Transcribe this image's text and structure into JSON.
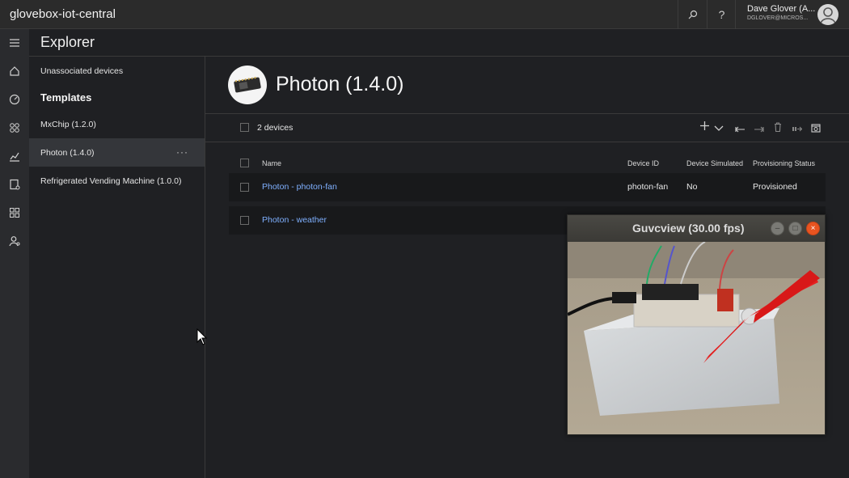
{
  "app": {
    "title": "glovebox-iot-central"
  },
  "topbar": {
    "search_icon": "search-icon",
    "help_label": "?",
    "user_name": "Dave Glover (A...",
    "user_email": "DGLOVER@MICROS..."
  },
  "rail": {
    "items": [
      "menu-icon",
      "home-icon",
      "dashboard-icon",
      "devices-icon",
      "analytics-icon",
      "jobs-icon",
      "templates-icon",
      "admin-icon"
    ]
  },
  "explorer": {
    "title": "Explorer"
  },
  "leftpanel": {
    "unassociated": "Unassociated devices",
    "templates_heading": "Templates",
    "templates": [
      {
        "label": "MxChip (1.2.0)"
      },
      {
        "label": "Photon (1.4.0)",
        "more": "···"
      },
      {
        "label": "Refrigerated Vending Machine (1.0.0)"
      }
    ]
  },
  "main": {
    "template_title": "Photon (1.4.0)",
    "device_count": "2 devices",
    "columns": {
      "name": "Name",
      "device_id": "Device ID",
      "simulated": "Device Simulated",
      "status": "Provisioning Status"
    },
    "rows": [
      {
        "name": "Photon - photon-fan",
        "device_id": "photon-fan",
        "simulated": "No",
        "status": "Provisioned"
      },
      {
        "name": "Photon - weather",
        "device_id": "",
        "simulated": "",
        "status": ""
      }
    ]
  },
  "guvcview": {
    "title": "Guvcview   (30.00 fps)",
    "min": "–",
    "max": "□",
    "close": "×"
  },
  "colors": {
    "link": "#7fb0ff",
    "close_button": "#e95420",
    "background": "#1f2023"
  }
}
